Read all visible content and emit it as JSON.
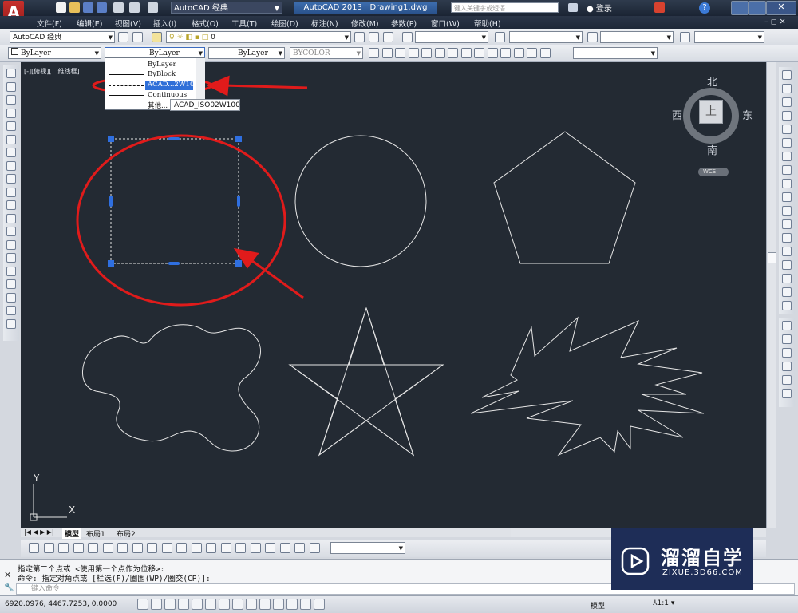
{
  "titlebar": {
    "workspace": "AutoCAD 经典",
    "app_title": "AutoCAD 2013",
    "doc_name": "Drawing1.dwg",
    "search_placeholder": "键入关键字或短语",
    "signin": "登录"
  },
  "menu": [
    "文件(F)",
    "编辑(E)",
    "视图(V)",
    "插入(I)",
    "格式(O)",
    "工具(T)",
    "绘图(D)",
    "标注(N)",
    "修改(M)",
    "参数(P)",
    "窗口(W)",
    "帮助(H)"
  ],
  "toolbar2": {
    "workspace_combo": "AutoCAD 经典",
    "layer_value": "0"
  },
  "toolbar3": {
    "color": "ByLayer",
    "linetype": "ByLayer",
    "lineweight": "ByLayer",
    "plotstyle": "BYCOLOR"
  },
  "linetype_dropdown": {
    "options": [
      "ByLayer",
      "ByBlock",
      "ACAD...2W100",
      "Continuous"
    ],
    "selected_index": 2,
    "other_label": "其他...",
    "tooltip": "ACAD_ISO02W100"
  },
  "viewport_label": "[-][俯视][二维线框]",
  "viewcube": {
    "north": "北",
    "south": "南",
    "east": "东",
    "west": "西",
    "top": "上",
    "wcs": "WCS"
  },
  "ucs": {
    "x": "X",
    "y": "Y"
  },
  "layout_tabs": [
    "模型",
    "布局1",
    "布局2"
  ],
  "command": {
    "line1": "指定第二个点或 <使用第一个点作为位移>:",
    "line2": "命令: 指定对角点或 [栏选(F)/圈围(WP)/圈交(CP)]:",
    "placeholder": "键入命令"
  },
  "status": {
    "coordinates": "6920.0976,  4467.7253, 0.0000",
    "model_label": "模型",
    "scale": "1:1"
  },
  "watermark": {
    "brand": "溜溜自学",
    "url": "ZIXUE.3D66.COM"
  },
  "colors": {
    "canvas": "#232a33",
    "annotation_red": "#e01b1b",
    "grip_blue": "#2f6fe0",
    "shape_stroke": "#e6e6e6"
  }
}
